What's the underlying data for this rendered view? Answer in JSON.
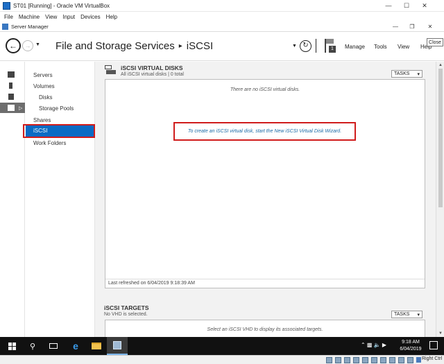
{
  "vbox": {
    "title": "ST01 [Running] - Oracle VM VirtualBox",
    "menu": [
      "File",
      "Machine",
      "View",
      "Input",
      "Devices",
      "Help"
    ],
    "controls": {
      "minimize": "—",
      "maximize": "☐",
      "close": "✕"
    }
  },
  "sm": {
    "window_title": "Server Manager",
    "controls": {
      "minimize": "—",
      "restore": "❐",
      "close": "✕"
    },
    "close_tooltip": "Close",
    "breadcrumb_parent": "File and Storage Services",
    "breadcrumb_sep": "▸",
    "breadcrumb_current": "iSCSI",
    "header_menu": {
      "manage": "Manage",
      "tools": "Tools",
      "view": "View",
      "help": "Help"
    },
    "notification_count": "1"
  },
  "nav": {
    "items": [
      {
        "label": "Servers"
      },
      {
        "label": "Volumes"
      },
      {
        "label": "Disks"
      },
      {
        "label": "Storage Pools"
      },
      {
        "label": "Shares"
      },
      {
        "label": "iSCSI"
      },
      {
        "label": "Work Folders"
      }
    ],
    "selected": "iSCSI"
  },
  "virtual_disks": {
    "title": "iSCSI VIRTUAL DISKS",
    "subtitle": "All iSCSI virtual disks | 0 total",
    "tasks_label": "TASKS",
    "empty_message": "There are no iSCSI virtual disks.",
    "wizard_link": "To create an iSCSI virtual disk, start the New iSCSI Virtual Disk Wizard.",
    "last_refreshed": "Last refreshed on 6/04/2019 9:18:39 AM"
  },
  "targets": {
    "title": "iSCSI TARGETS",
    "subtitle": "No VHD is selected.",
    "tasks_label": "TASKS",
    "empty_message": "Select an iSCSI VHD to display its associated targets."
  },
  "taskbar": {
    "time": "9:18 AM",
    "date": "6/04/2019"
  },
  "vbox_status": {
    "host_key": "Right Ctrl"
  },
  "colors": {
    "selection_blue": "#0a6bc4",
    "highlight_red": "#d01c1c",
    "link_blue": "#1a6aa6"
  }
}
